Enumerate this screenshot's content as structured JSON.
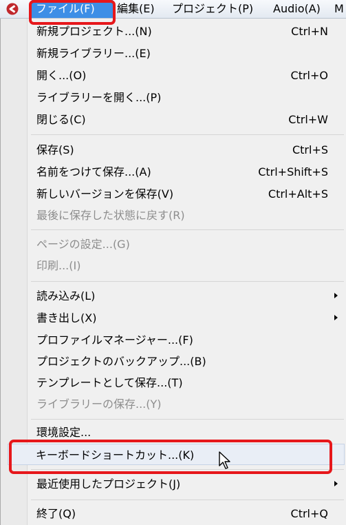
{
  "menubar": {
    "items": [
      {
        "label": "ファイル(F)"
      },
      {
        "label": "編集(E)"
      },
      {
        "label": "プロジェクト(P)"
      },
      {
        "label": "Audio(A)"
      },
      {
        "label": "M"
      }
    ],
    "active_index": 0
  },
  "file_menu": {
    "items": [
      {
        "label": "新規プロジェクト...(N)",
        "shortcut": "Ctrl+N"
      },
      {
        "label": "新規ライブラリー...(E)",
        "shortcut": ""
      },
      {
        "label": "開く...(O)",
        "shortcut": "Ctrl+O"
      },
      {
        "label": "ライブラリーを開く...(P)",
        "shortcut": ""
      },
      {
        "label": "閉じる(C)",
        "shortcut": "Ctrl+W"
      },
      {
        "label": "保存(S)",
        "shortcut": "Ctrl+S"
      },
      {
        "label": "名前をつけて保存...(A)",
        "shortcut": "Ctrl+Shift+S"
      },
      {
        "label": "新しいバージョンを保存(V)",
        "shortcut": "Ctrl+Alt+S"
      },
      {
        "label": "最後に保存した状態に戻す(R)",
        "shortcut": ""
      },
      {
        "label": "ページの設定...(G)",
        "shortcut": ""
      },
      {
        "label": "印刷...(I)",
        "shortcut": ""
      },
      {
        "label": "読み込み(L)",
        "shortcut": ""
      },
      {
        "label": "書き出し(X)",
        "shortcut": ""
      },
      {
        "label": "プロファイルマネージャー...(F)",
        "shortcut": ""
      },
      {
        "label": "プロジェクトのバックアップ...(B)",
        "shortcut": ""
      },
      {
        "label": "テンプレートとして保存...(T)",
        "shortcut": ""
      },
      {
        "label": "ライブラリーの保存...(Y)",
        "shortcut": ""
      },
      {
        "label": "環境設定...",
        "shortcut": ""
      },
      {
        "label": "キーボードショートカット...(K)",
        "shortcut": ""
      },
      {
        "label": "最近使用したプロジェクト(J)",
        "shortcut": ""
      },
      {
        "label": "終了(Q)",
        "shortcut": "Ctrl+Q"
      }
    ],
    "hovered_item": "キーボードショートカット...(K)"
  },
  "colors": {
    "highlight_border": "#e6171b",
    "menubar_active": "#3d8ee6",
    "disabled_text": "#8d8d8d",
    "app_icon": "#c0282d"
  },
  "icons": {
    "app": "cubase-logo-icon",
    "cursor": "mouse-pointer-icon",
    "submenu": "chevron-right-icon"
  }
}
